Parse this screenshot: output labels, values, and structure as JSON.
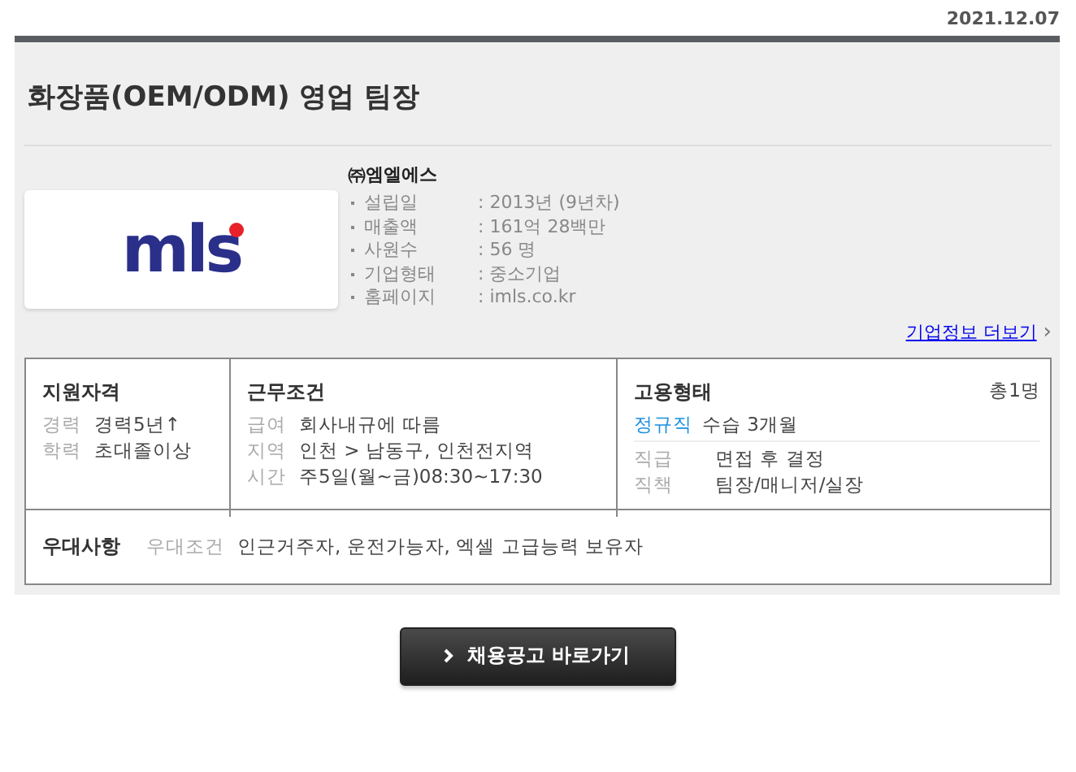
{
  "date": "2021.12.07",
  "title": "화장품(OEM/ODM) 영업 팀장",
  "company": {
    "logo_text": "mls",
    "name": "㈜엠엘에스",
    "facts": [
      {
        "label": "설립일",
        "value": ": 2013년 (9년차)"
      },
      {
        "label": "매출액",
        "value": ": 161억 28백만"
      },
      {
        "label": "사원수",
        "value": ": 56 명"
      },
      {
        "label": "기업형태",
        "value": ": 중소기업"
      },
      {
        "label": "홈페이지",
        "value": ": imls.co.kr"
      }
    ],
    "more_link": "기업정보 더보기",
    "more_arrow": "›"
  },
  "qualification": {
    "heading": "지원자격",
    "rows": [
      {
        "label": "경력",
        "value": "경력5년↑"
      },
      {
        "label": "학력",
        "value": "초대졸이상"
      }
    ]
  },
  "conditions": {
    "heading": "근무조건",
    "rows": [
      {
        "label": "급여",
        "value": "회사내규에 따름"
      },
      {
        "label": "지역",
        "value": "인천 > 남동구, 인천전지역"
      },
      {
        "label": "시간",
        "value": "주5일(월~금)08:30~17:30"
      }
    ]
  },
  "employment": {
    "heading": "고용형태",
    "count": "총1명",
    "type": "정규직",
    "type_note": "수습 3개월",
    "rows": [
      {
        "label": "직급",
        "value": "면접 후 결정"
      },
      {
        "label": "직책",
        "value": "팀장/매니저/실장"
      }
    ]
  },
  "preferences": {
    "heading": "우대사항",
    "label": "우대조건",
    "value": "인근거주자, 운전가능자, 엑셀 고급능력 보유자"
  },
  "apply_button": "채용공고 바로가기"
}
